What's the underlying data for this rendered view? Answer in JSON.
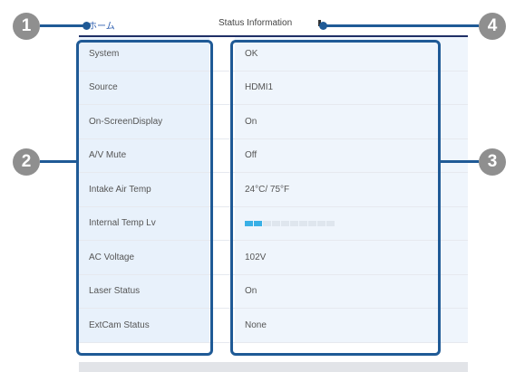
{
  "header": {
    "home_chevron": "‹",
    "home_label": "ホーム",
    "title": "Status Information"
  },
  "rows": [
    {
      "label": "System",
      "value": "OK"
    },
    {
      "label": "Source",
      "value": "HDMI1"
    },
    {
      "label": "On-ScreenDisplay",
      "value": "On"
    },
    {
      "label": "A/V Mute",
      "value": "Off"
    },
    {
      "label": "Intake Air Temp",
      "value": "24°C/ 75°F"
    },
    {
      "label": "Internal Temp Lv",
      "value": "",
      "level": 0.2
    },
    {
      "label": "AC Voltage",
      "value": "102V"
    },
    {
      "label": "Laser Status",
      "value": "On"
    },
    {
      "label": "ExtCam Status",
      "value": "None"
    }
  ],
  "callouts": [
    "1",
    "2",
    "3",
    "4"
  ],
  "colors": {
    "accent": "#1f5a96",
    "badge": "#8f8f8f",
    "header_rule": "#1f2f66",
    "label_bg": "#e8f1fb",
    "value_bg": "#eff5fc",
    "temp_on": "#39b0e6"
  }
}
